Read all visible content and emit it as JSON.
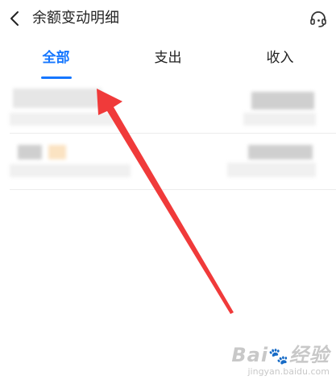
{
  "header": {
    "title": "余额变动明细",
    "back_icon": "chevron-left-icon",
    "service_icon": "customer-service-icon"
  },
  "tabs": [
    {
      "label": "全部",
      "active": true
    },
    {
      "label": "支出",
      "active": false
    },
    {
      "label": "收入",
      "active": false
    }
  ],
  "watermark": {
    "main": "Bai",
    "paw": "🐾",
    "suffix": "经验",
    "sub": "jingyan.baidu.com"
  },
  "colors": {
    "accent": "#1677ff",
    "arrow": "#f03a3a"
  }
}
